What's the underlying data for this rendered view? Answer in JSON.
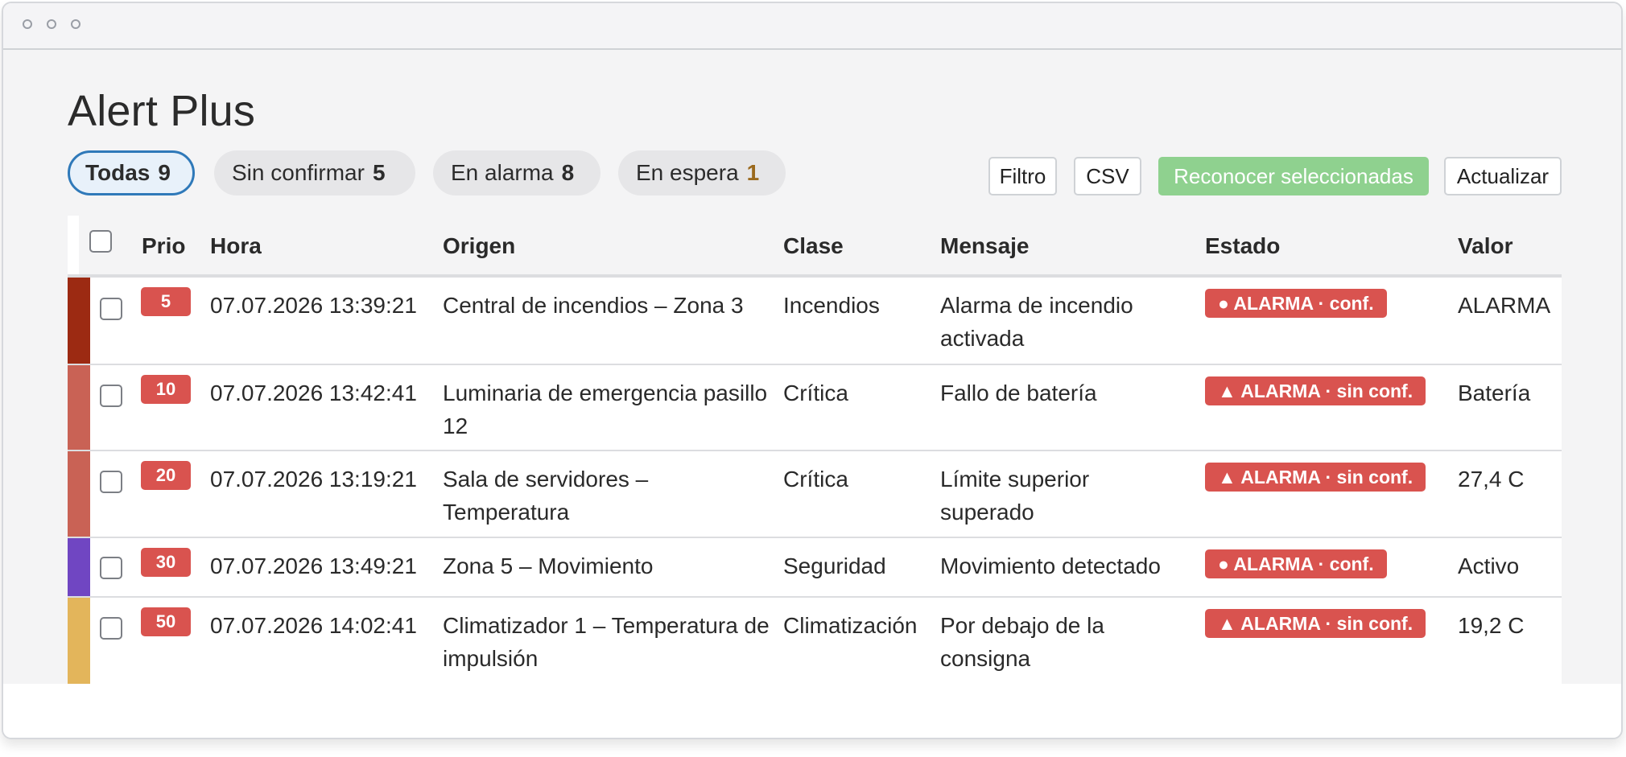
{
  "app": {
    "title": "Alert Plus"
  },
  "filters": [
    {
      "label": "Todas",
      "count": "9"
    },
    {
      "label": "Sin confirmar",
      "count": "5"
    },
    {
      "label": "En alarma",
      "count": "8"
    },
    {
      "label": "En espera",
      "count": "1"
    }
  ],
  "toolbar": {
    "filter_label": "Filtro",
    "csv_label": "CSV",
    "ack_label": "Reconocer seleccionadas",
    "refresh_label": "Actualizar"
  },
  "table": {
    "headers": {
      "prio": "Prio",
      "hora": "Hora",
      "origen": "Origen",
      "clase": "Clase",
      "mensaje": "Mensaje",
      "estado": "Estado",
      "valor": "Valor"
    },
    "rows": [
      {
        "prio": "5",
        "hora": "07.07.2026 13:39:21",
        "origen": "Central de incendios – Zona 3",
        "clase": "Incendios",
        "mensaje": "Alarma de incendio activada",
        "estado": "● ALARMA · conf.",
        "valor": "ALARMA",
        "bar_color": "#9c2a12"
      },
      {
        "prio": "10",
        "hora": "07.07.2026 13:42:41",
        "origen": "Luminaria de emergencia pasillo 12",
        "clase": "Crítica",
        "mensaje": "Fallo de batería",
        "estado": "▲ ALARMA · sin conf.",
        "valor": "Batería",
        "bar_color": "#c96255"
      },
      {
        "prio": "20",
        "hora": "07.07.2026 13:19:21",
        "origen": "Sala de servidores – Temperatura",
        "clase": "Crítica",
        "mensaje": "Límite superior superado",
        "estado": "▲ ALARMA · sin conf.",
        "valor": "27,4 C",
        "bar_color": "#c96255"
      },
      {
        "prio": "30",
        "hora": "07.07.2026 13:49:21",
        "origen": "Zona 5 – Movimiento",
        "clase": "Seguridad",
        "mensaje": "Movimiento detectado",
        "estado": "● ALARMA · conf.",
        "valor": "Activo",
        "bar_color": "#7046c2"
      },
      {
        "prio": "50",
        "hora": "07.07.2026 14:02:41",
        "origen": "Climatizador 1 – Temperatura de impulsión",
        "clase": "Climatización",
        "mensaje": "Por debajo de la consigna",
        "estado": "▲ ALARMA · sin conf.",
        "valor": "19,2 C",
        "bar_color": "#e3b55b"
      }
    ]
  },
  "colors": {
    "accent": "#2f79b9",
    "alarm": "#d9534f",
    "primary_button": "#8fd18f",
    "espera_count": "#9b6a1e"
  }
}
